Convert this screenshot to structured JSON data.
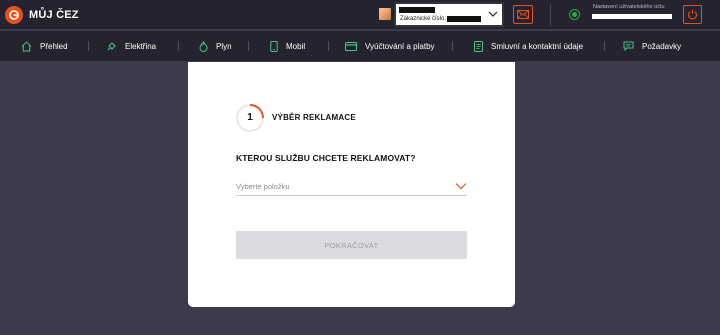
{
  "header": {
    "logo_text": "MŮJ ČEZ",
    "customer_caption": "Zákaznické číslo:",
    "account_settings_label": "Nastavení uživatelského účtu"
  },
  "nav": {
    "items": [
      {
        "label": "Přehled",
        "icon": "home-icon"
      },
      {
        "label": "Elektřina",
        "icon": "lightning-plug-icon"
      },
      {
        "label": "Plyn",
        "icon": "flame-icon"
      },
      {
        "label": "Mobil",
        "icon": "phone-icon"
      },
      {
        "label": "Vyúčtování a platby",
        "icon": "card-icon"
      },
      {
        "label": "Smluvní a kontaktní údaje",
        "icon": "document-icon"
      },
      {
        "label": "Požadavky",
        "icon": "chat-icon"
      }
    ]
  },
  "card": {
    "step_number": "1",
    "step_title": "VÝBĚR REKLAMACE",
    "question": "KTEROU SLUŽBU CHCETE REKLAMOVAT?",
    "select_placeholder": "Vyberte položku",
    "continue_label": "POKRAČOVAT"
  },
  "colors": {
    "accent": "#e8511b",
    "header_bg": "#24232f",
    "page_bg": "#3c3a4b",
    "disabled_button": "#dcdce0"
  }
}
